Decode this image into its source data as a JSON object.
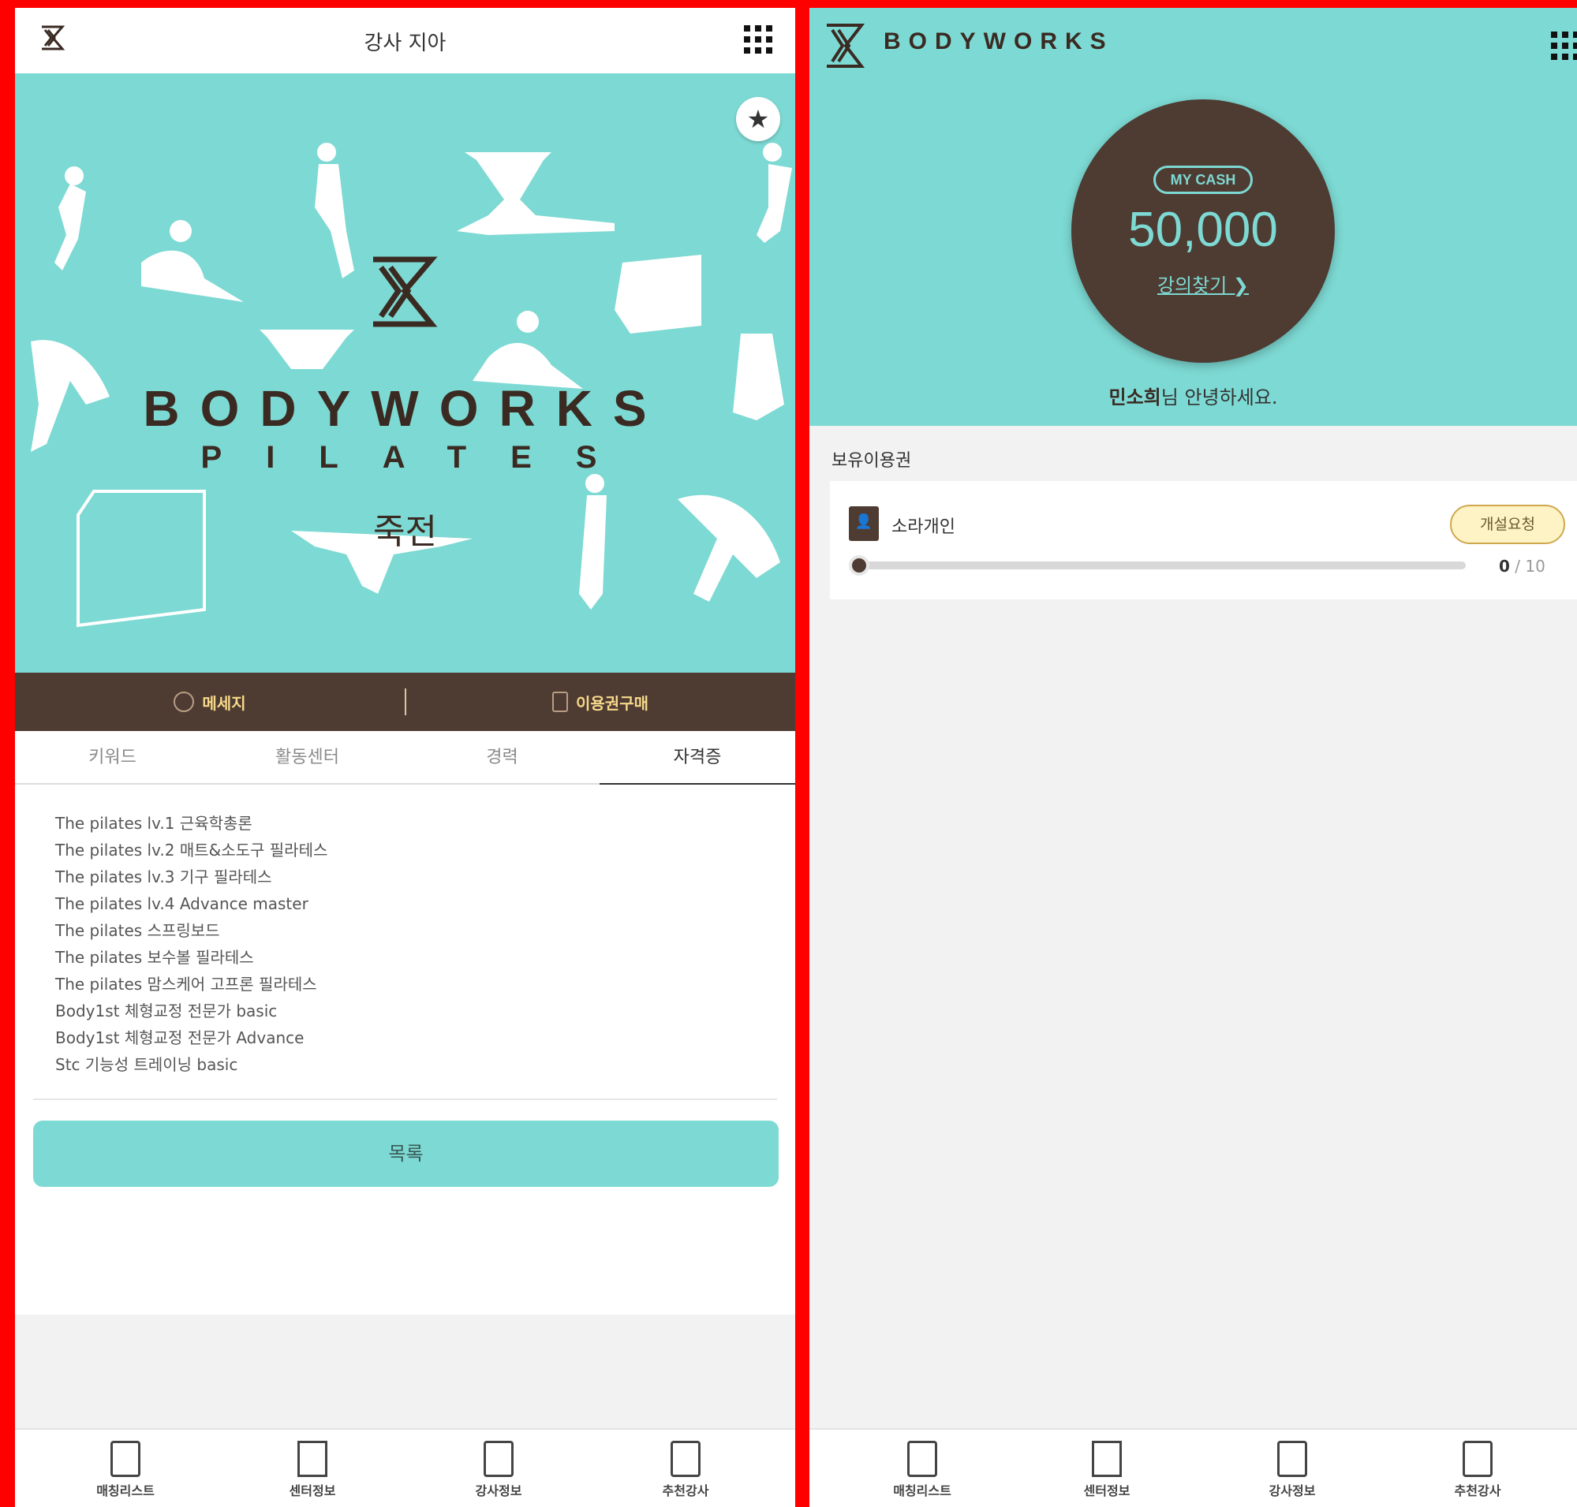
{
  "left": {
    "header": {
      "title": "강사 지아"
    },
    "hero": {
      "brand": "BODYWORKS",
      "brand_sub": "PILATES",
      "name": "죽전"
    },
    "actions": {
      "message": "메세지",
      "buy": "이용권구매"
    },
    "tabs": [
      "키워드",
      "활동센터",
      "경력",
      "자격증"
    ],
    "active_tab": 3,
    "certifications": [
      "The pilates lv.1 근육학총론",
      "The pilates lv.2 매트&소도구 필라테스",
      "The pilates lv.3 기구 필라테스",
      "The pilates lv.4 Advance master",
      "The pilates 스프링보드",
      "The pilates 보수볼 필라테스",
      "The pilates 맘스케어 고프론 필라테스",
      "Body1st 체형교정 전문가 basic",
      "Body1st 체형교정 전문가 Advance",
      "Stc 기능성 트레이닝 basic"
    ],
    "list_button": "목록"
  },
  "right": {
    "brand": "BODYWORKS",
    "cash": {
      "badge": "MY CASH",
      "value": "50,000",
      "link": "강의찾기"
    },
    "greeting": {
      "name": "민소희",
      "suffix": "님 안녕하세요."
    },
    "section_title": "보유이용권",
    "ticket": {
      "name": "소라개인",
      "button": "개설요청",
      "used": "0",
      "total": "/ 10",
      "progress": 0
    }
  },
  "nav": [
    "매칭리스트",
    "센터정보",
    "강사정보",
    "추천강사"
  ],
  "colors": {
    "mint": "#7dd9d3",
    "brown": "#4e3b32",
    "gold": "#f7d98a",
    "frame": "#ff0000"
  }
}
